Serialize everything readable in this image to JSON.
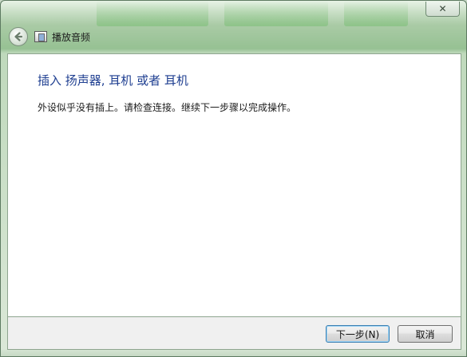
{
  "window": {
    "title": "播放音频",
    "close_glyph": "✕"
  },
  "content": {
    "heading": "插入 扬声器, 耳机 或者 耳机",
    "message": "外设似乎没有插上。请检查连接。继续下一步骤以完成操作。"
  },
  "buttons": {
    "next_label": "下一步(N)",
    "cancel_label": "取消"
  },
  "icons": {
    "back": "back-arrow-icon",
    "title": "app-icon",
    "close": "close-icon"
  },
  "colors": {
    "heading": "#1f3f91",
    "frame_green": "#96c193",
    "default_button_border": "#3c7fb1"
  }
}
